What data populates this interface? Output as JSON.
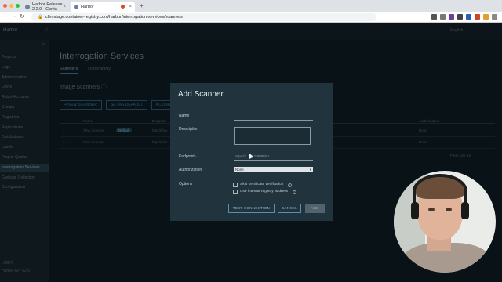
{
  "browser": {
    "tabs": [
      {
        "title": "Harbor Release 2.2.0 · Conta"
      },
      {
        "title": "Harbor"
      }
    ],
    "url": "c8n-stage.container-registry.com/harbor/interrogation-services/scanners",
    "window_dot_colors": [
      "#ff5f57",
      "#febc2e",
      "#28c840"
    ],
    "extension_colors": [
      "#555555",
      "#777777",
      "#6b3fa0",
      "#444444",
      "#2b5fb4",
      "#c8462c",
      "#e0a12a",
      "#8a8a8a"
    ]
  },
  "harbor": {
    "brand": "Harbor",
    "language": "English",
    "sidebar": {
      "items": [
        {
          "label": "Projects"
        },
        {
          "label": "Logs"
        },
        {
          "label": "Administration"
        },
        {
          "label": "Users"
        },
        {
          "label": "Robot Accounts"
        },
        {
          "label": "Groups"
        },
        {
          "label": "Registries"
        },
        {
          "label": "Replications"
        },
        {
          "label": "Distributions"
        },
        {
          "label": "Labels"
        },
        {
          "label": "Project Quotas"
        },
        {
          "label": "Interrogation Services"
        },
        {
          "label": "Garbage Collection"
        },
        {
          "label": "Configuration"
        }
      ]
    },
    "page_title": "Interrogation Services",
    "tabs": [
      {
        "label": "Scanners"
      },
      {
        "label": "Vulnerability"
      }
    ],
    "section_title": "Image Scanners",
    "toolbar": [
      {
        "label": "+ NEW SCANNER"
      },
      {
        "label": "SET AS DEFAULT"
      },
      {
        "label": "ACTION"
      }
    ],
    "grid": {
      "headers": [
        "Name",
        "Endpoint",
        "Authorization"
      ],
      "rows": [
        {
          "name": "Trivy Scanner",
          "badge": "Default",
          "endpoint": "http://trivy",
          "auth": "None"
        },
        {
          "name": "Clair Scanner",
          "badge": "",
          "endpoint": "http://clair",
          "auth": "None"
        }
      ],
      "pager": "Page size 15"
    },
    "footer": [
      "LIGHT",
      "Harbor API V2.0"
    ]
  },
  "modal": {
    "title": "Add Scanner",
    "labels": {
      "name": "Name",
      "description": "Description",
      "endpoint": "Endpoint",
      "authorization": "Authorization",
      "options": "Options"
    },
    "endpoint_value": "https://1.1.1.1:8080/v1",
    "authorization_value": "None",
    "options": [
      {
        "label": "Skip certificate verification"
      },
      {
        "label": "Use internal registry address"
      }
    ],
    "buttons": {
      "test": "TEST CONNECTION",
      "cancel": "CANCEL",
      "add": "ADD"
    }
  }
}
